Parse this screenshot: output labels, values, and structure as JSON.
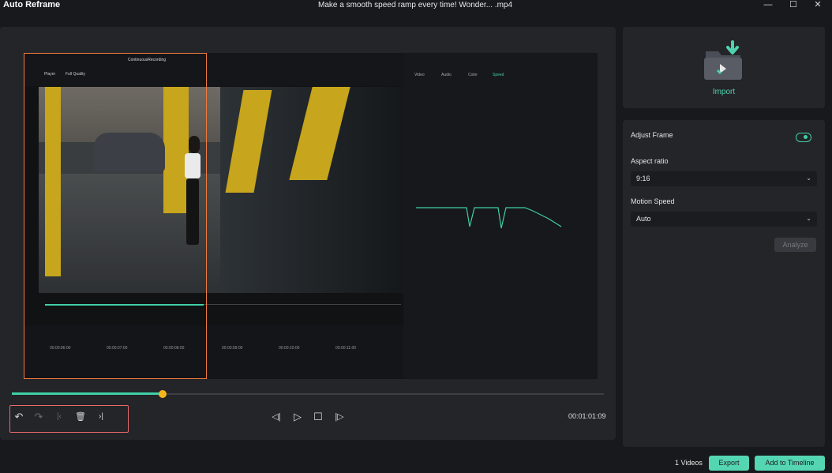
{
  "titlebar": {
    "app_title": "Auto Reframe",
    "file_title": "Make a smooth speed ramp every time!  Wonder... .mp4",
    "minimize": "—",
    "maximize": "☐",
    "close": "✕"
  },
  "preview": {
    "video_header": "ContinuousRecording",
    "player_label": "Player",
    "quality_label": "Full Quality",
    "right_tabs": [
      "Video",
      "Audio",
      "Color",
      "Speed"
    ],
    "timeline_ticks": [
      "00:00:06:00",
      "00:00:07:00",
      "00:00:08:00",
      "00:00:09:00",
      "00:00:10:00",
      "00:00:11:00"
    ]
  },
  "playback": {
    "progress_fraction": 0.25,
    "timecode": "00:01:01:09",
    "icons": {
      "undo": "↶",
      "redo": "↷",
      "prev_marker": "|‹",
      "delete": "🗑",
      "next_marker": "›|",
      "step_back": "◁|",
      "play": "▷",
      "stop": "☐",
      "step_forward": "|▷"
    }
  },
  "import_panel": {
    "label": "Import"
  },
  "settings": {
    "adjust_frame_label": "Adjust Frame",
    "adjust_frame_on": true,
    "aspect_ratio_label": "Aspect ratio",
    "aspect_ratio_value": "9:16",
    "motion_speed_label": "Motion Speed",
    "motion_speed_value": "Auto",
    "analyze_label": "Analyze"
  },
  "footer": {
    "videos_count": "1 Videos",
    "export_label": "Export",
    "add_to_timeline_label": "Add to Timeline"
  },
  "colors": {
    "accent": "#55d6b2",
    "reframe_border": "#f07a3e",
    "scrub_handle": "#f5b51b",
    "group_highlight": "#e86a6a"
  }
}
